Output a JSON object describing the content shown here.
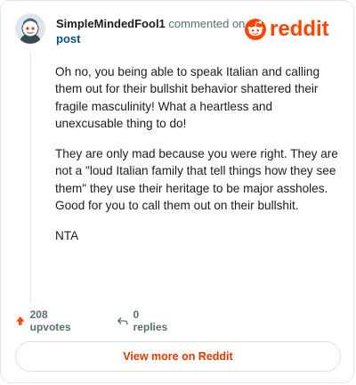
{
  "comment": {
    "username": "SimpleMindedFool1",
    "action_text": "commented on",
    "post_link": "post",
    "paragraphs": [
      "Oh no, you being able to speak Italian and calling them out for their bullshit behavior shattered their fragile masculinity! What a heartless and unexcusable thing to do!",
      "They are only mad because you were right. They are not a \"loud Italian family that tell things how they see them\" they use their heritage to be major assholes. Good for you to call them out on their bullshit.",
      "NTA"
    ],
    "upvotes": "208 upvotes",
    "replies": "0 replies"
  },
  "brand": {
    "logo_text": "reddit",
    "color": "#ff4500"
  },
  "footer": {
    "view_more_label": "View more on Reddit"
  },
  "colors": {
    "upvote": "#ff4500",
    "link": "#0b4f8a",
    "view_more": "#d93a00"
  }
}
